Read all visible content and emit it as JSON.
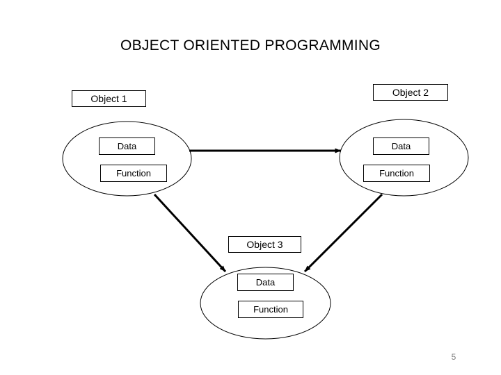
{
  "slide": {
    "title": "OBJECT ORIENTED PROGRAMMING",
    "page_number": "5",
    "background_color": "#ffffff",
    "stroke_color": "#000000",
    "page_number_color": "#808080"
  },
  "objects": [
    {
      "id": "object-1",
      "label": "Object 1",
      "members": [
        {
          "name": "data",
          "label": "Data"
        },
        {
          "name": "function",
          "label": "Function"
        }
      ]
    },
    {
      "id": "object-2",
      "label": "Object 2",
      "members": [
        {
          "name": "data",
          "label": "Data"
        },
        {
          "name": "function",
          "label": "Function"
        }
      ]
    },
    {
      "id": "object-3",
      "label": "Object 3",
      "members": [
        {
          "name": "data",
          "label": "Data"
        },
        {
          "name": "function",
          "label": "Function"
        }
      ]
    }
  ],
  "connections": [
    {
      "name": "object-1-to-object-2",
      "from": "Object 1",
      "to": "Object 2",
      "style": "arrow"
    },
    {
      "name": "object-1-to-object-3",
      "from": "Object 1",
      "to": "Object 3",
      "style": "arrow"
    },
    {
      "name": "object-2-to-object-3",
      "from": "Object 2",
      "to": "Object 3",
      "style": "arrow"
    }
  ]
}
